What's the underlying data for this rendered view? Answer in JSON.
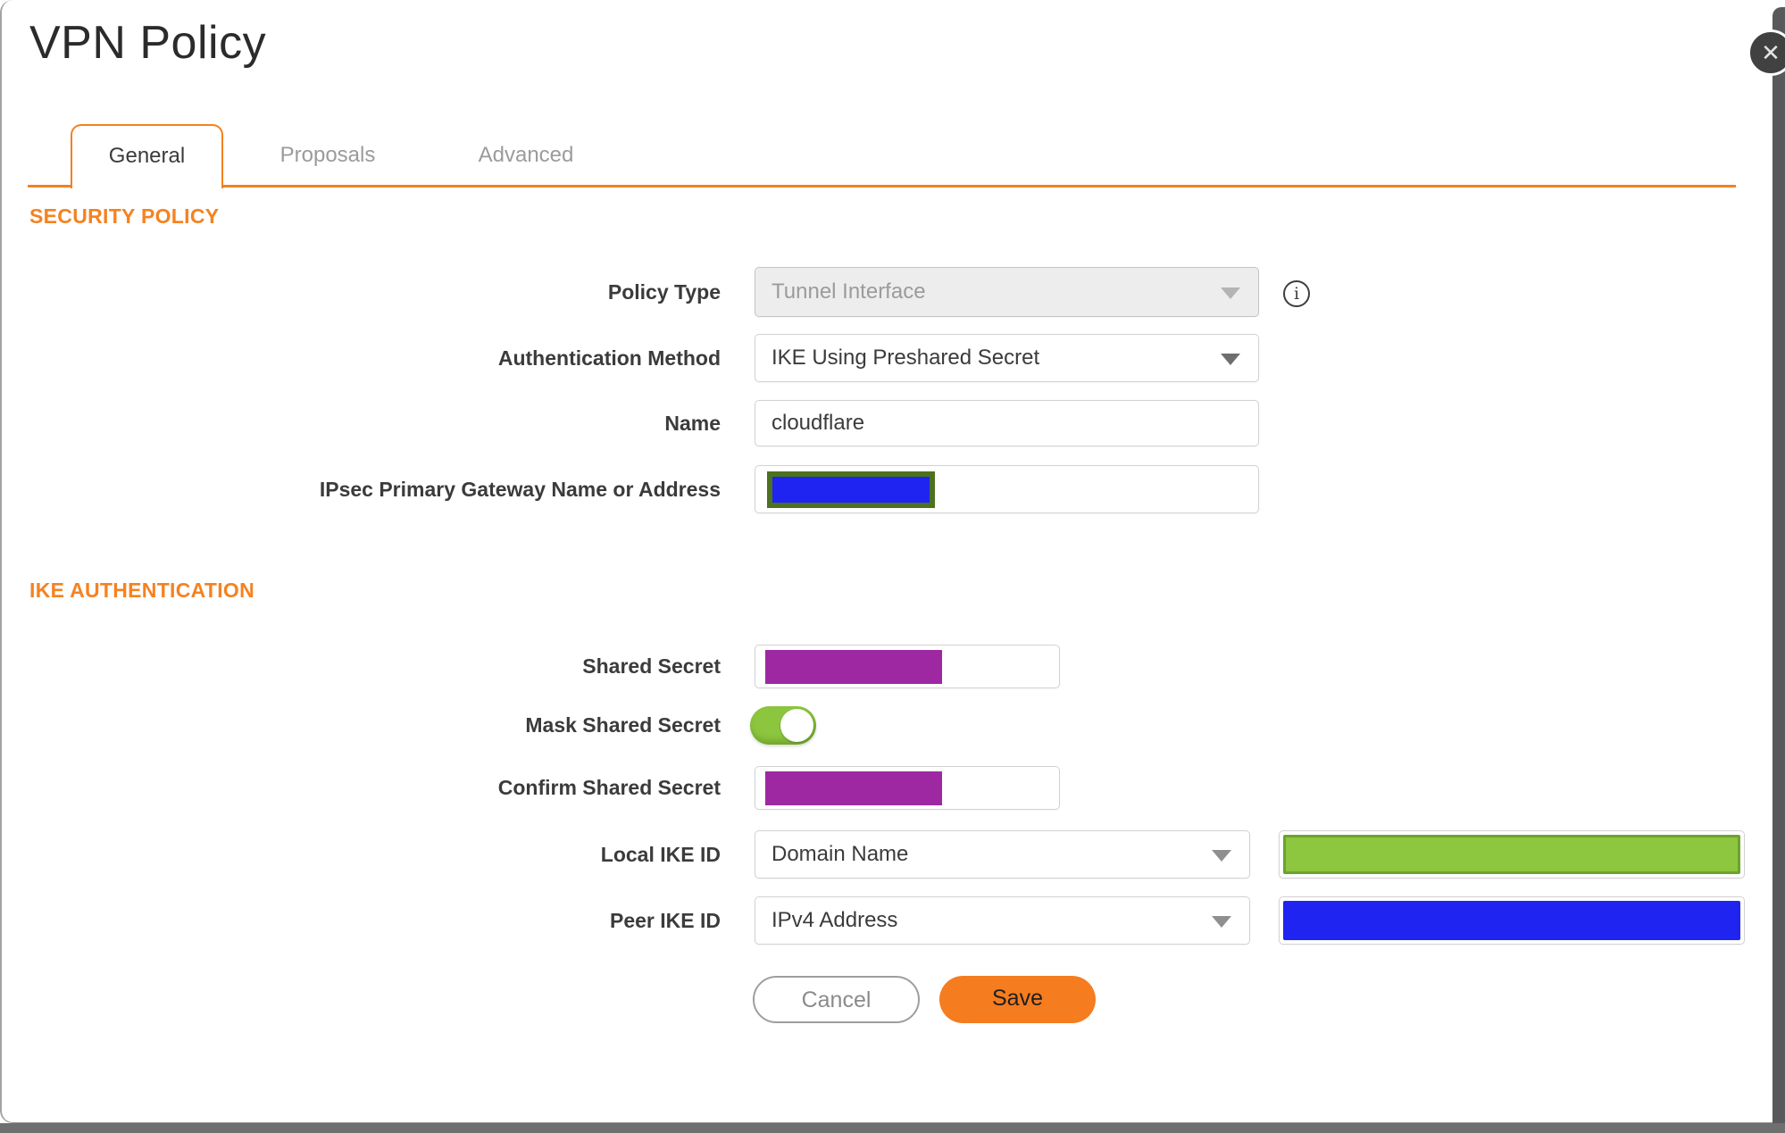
{
  "dialog": {
    "title": "VPN Policy",
    "close_icon": "✕"
  },
  "tabs": {
    "items": [
      {
        "label": "General",
        "active": true
      },
      {
        "label": "Proposals",
        "active": false
      },
      {
        "label": "Advanced",
        "active": false
      }
    ]
  },
  "sections": {
    "security_policy": "SECURITY POLICY",
    "ike_authentication": "IKE AUTHENTICATION"
  },
  "fields": {
    "policy_type": {
      "label": "Policy Type",
      "value": "Tunnel Interface",
      "disabled": true
    },
    "authentication_method": {
      "label": "Authentication Method",
      "value": "IKE Using Preshared Secret"
    },
    "name": {
      "label": "Name",
      "value": "cloudflare"
    },
    "gateway": {
      "label": "IPsec Primary Gateway Name or Address",
      "value_redacted": true
    },
    "shared_secret": {
      "label": "Shared Secret",
      "value_redacted": true
    },
    "mask_shared_secret": {
      "label": "Mask Shared Secret",
      "state": "on"
    },
    "confirm_shared_secret": {
      "label": "Confirm Shared Secret",
      "value_redacted": true
    },
    "local_ike_id": {
      "label": "Local IKE ID",
      "type_value": "Domain Name",
      "value_redacted": true
    },
    "peer_ike_id": {
      "label": "Peer IKE ID",
      "type_value": "IPv4 Address",
      "value_redacted": true
    }
  },
  "icons": {
    "info": "i",
    "dropdown_caret": "caret-down"
  },
  "buttons": {
    "cancel": "Cancel",
    "save": "Save"
  },
  "colors": {
    "accent_orange": "#f48120",
    "section_orange": "#f58220",
    "save_orange": "#f57c1f",
    "toggle_green": "#8cc63f",
    "redaction_purple": "#9e28a2",
    "redaction_blue": "#1f24f0",
    "redaction_green_fill": "#8dc63f",
    "redaction_green_border": "#6ba32c",
    "gateway_redaction_border": "#4c7220",
    "backdrop_gray": "#58595b",
    "label_text": "#3b3b3b"
  }
}
